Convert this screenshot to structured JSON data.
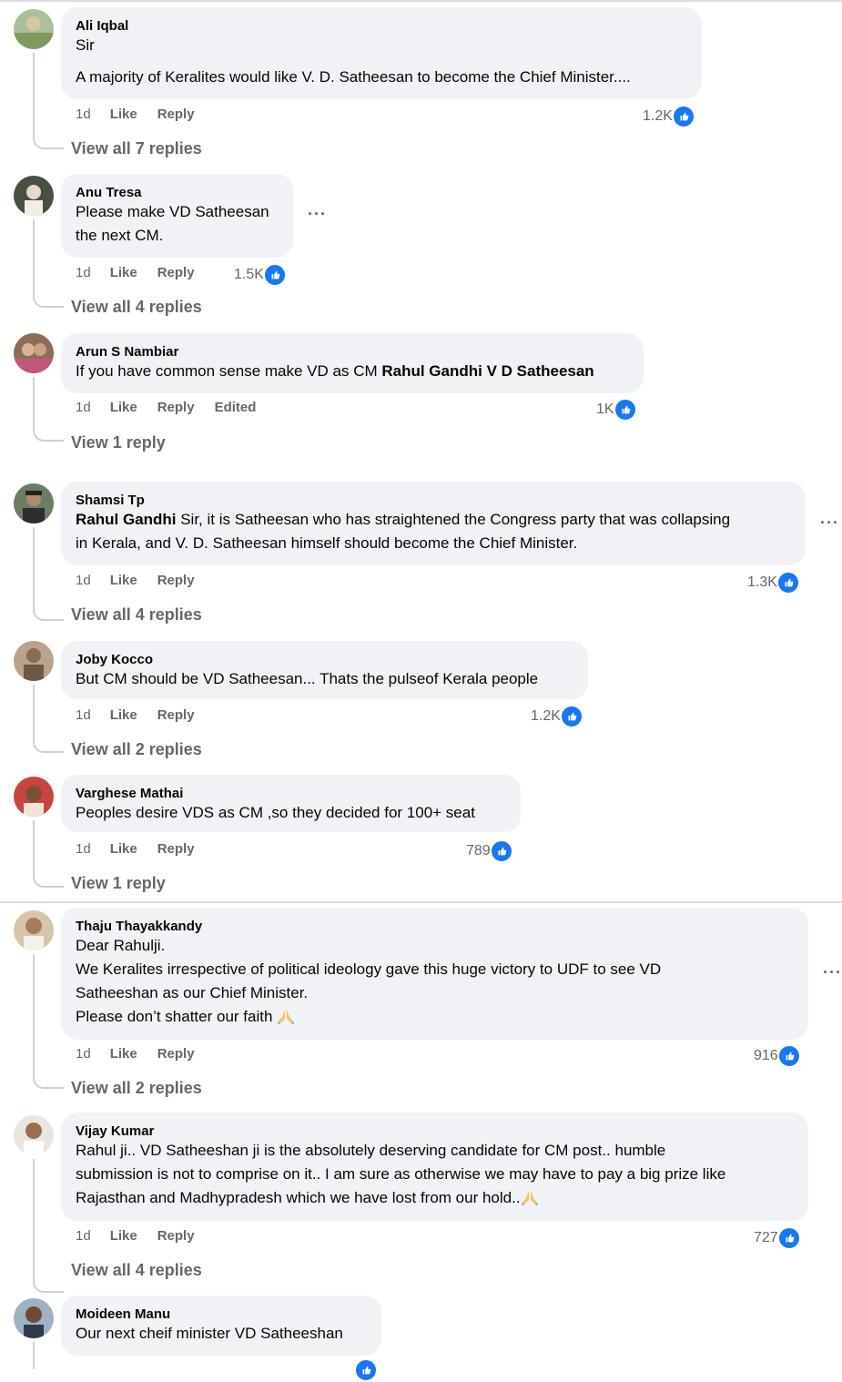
{
  "like_color": "#1877f2",
  "comments": [
    {
      "name": "Ali Iqbal",
      "lines": [
        "Sir",
        "A majority of Keralites would like V. D. Satheesan to become the Chief Minister...."
      ],
      "time": "1d",
      "like": "Like",
      "reply": "Reply",
      "reactions": "1.2K",
      "view_replies": "View all 7 replies"
    },
    {
      "name": "Anu Tresa",
      "lines": [
        "Please make VD Satheesan",
        "the next CM."
      ],
      "time": "1d",
      "like": "Like",
      "reply": "Reply",
      "reactions": "1.5K",
      "view_replies": "View all 4 replies",
      "more": "···"
    },
    {
      "name": "Arun S Nambiar",
      "text_prefix": "If you have common sense make VD as CM ",
      "text_bold": "Rahul Gandhi V D Satheesan",
      "time": "1d",
      "like": "Like",
      "reply": "Reply",
      "edited": "Edited",
      "reactions": "1K",
      "view_replies": "View 1 reply"
    },
    {
      "name": "Shamsi Tp",
      "text_bold": "Rahul Gandhi",
      "line1_rest": " Sir, it is Satheesan who has straightened the Congress party that was collapsing",
      "line2": "in Kerala, and V. D. Satheesan himself should become the Chief Minister.",
      "time": "1d",
      "like": "Like",
      "reply": "Reply",
      "reactions": "1.3K",
      "view_replies": "View all 4 replies",
      "more": "···"
    },
    {
      "name": "Joby Kocco",
      "lines": [
        "But CM should be VD Satheesan... Thats the pulseof Kerala people"
      ],
      "time": "1d",
      "like": "Like",
      "reply": "Reply",
      "reactions": "1.2K",
      "view_replies": "View all 2 replies"
    },
    {
      "name": "Varghese Mathai",
      "lines": [
        "Peoples desire VDS as CM ,so they decided for 100+ seat"
      ],
      "time": "1d",
      "like": "Like",
      "reply": "Reply",
      "reactions": "789",
      "view_replies": "View 1 reply"
    },
    {
      "name": "Thaju Thayakkandy",
      "lines": [
        "Dear Rahulji.",
        "We Keralites irrespective of political ideology gave this huge victory to UDF to see VD",
        "Satheeshan as our Chief Minister.",
        "Please don’t shatter our faith"
      ],
      "time": "1d",
      "like": "Like",
      "reply": "Reply",
      "reactions": "916",
      "view_replies": "View all 2 replies",
      "more": "···"
    },
    {
      "name": "Vijay Kumar",
      "lines": [
        "Rahul ji.. VD Satheeshan ji is the absolutely deserving candidate for CM post.. humble",
        "submission is not to comprise on it.. I am sure as otherwise we may have to pay a big prize like",
        "Rajasthan and Madhypradesh which we have lost from our hold.."
      ],
      "time": "1d",
      "like": "Like",
      "reply": "Reply",
      "reactions": "727",
      "view_replies": "View all 4 replies"
    },
    {
      "name": "Moideen Manu",
      "lines": [
        "Our next cheif minister VD Satheeshan"
      ]
    }
  ]
}
